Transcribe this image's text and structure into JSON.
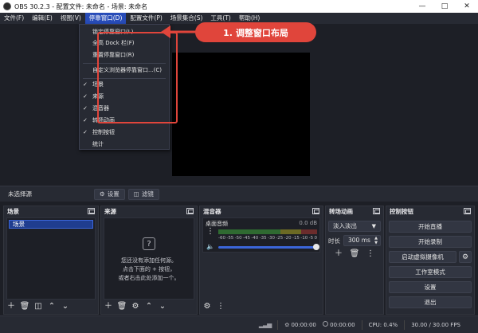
{
  "titlebar": {
    "title": "OBS 30.2.3 - 配置文件: 未命名 - 场景: 未命名"
  },
  "menubar": {
    "items": [
      "文件(F)",
      "编辑(E)",
      "视图(V)",
      "停靠窗口(D)",
      "配置文件(P)",
      "场景集合(S)",
      "工具(T)",
      "帮助(H)"
    ]
  },
  "dock_menu": {
    "lock": "锁定停靠窗口(L)",
    "full_height": "全高 Dock 栏(F)",
    "reset": "重置停靠窗口(R)",
    "custom_browser": "自定义浏览器停靠窗口...(C)",
    "scenes": "场景",
    "sources": "来源",
    "mixer": "混音器",
    "transitions": "转场动画",
    "controls": "控制按钮",
    "stats": "统计"
  },
  "annotation": {
    "label": "1. 调整窗口布局",
    "color": "#e0453b"
  },
  "context_bar": {
    "no_source": "未选择源",
    "properties": "设置",
    "filters": "滤镜"
  },
  "scenes_dock": {
    "title": "场景",
    "items": [
      "场景"
    ]
  },
  "sources_dock": {
    "title": "来源",
    "empty_line1": "您还没有添加任何源。",
    "empty_line2": "点击下面的 + 按钮，",
    "empty_line3": "或者右击此处添加一个。"
  },
  "mixer_dock": {
    "title": "混音器",
    "track_name": "桌面音频",
    "db": "0.0 dB",
    "scale": [
      "-60",
      "-55",
      "-50",
      "-45",
      "-40",
      "-35",
      "-30",
      "-25",
      "-20",
      "-15",
      "-10",
      "-5",
      "0"
    ]
  },
  "transitions_dock": {
    "title": "转场动画",
    "selected": "淡入淡出",
    "duration_label": "时长",
    "duration": "300 ms"
  },
  "controls_dock": {
    "title": "控制按钮",
    "start_stream": "开始直播",
    "start_record": "开始录制",
    "virtual_cam": "启动虚拟摄像机",
    "studio_mode": "工作室模式",
    "settings": "设置",
    "exit": "退出"
  },
  "statusbar": {
    "stream_time": "00:00:00",
    "record_time": "00:00:00",
    "cpu": "CPU: 0.4%",
    "fps": "30.00 / 30.00 FPS"
  },
  "colors": {
    "accent": "#284cb8",
    "panel": "#272a33",
    "background": "#1d1f26"
  }
}
